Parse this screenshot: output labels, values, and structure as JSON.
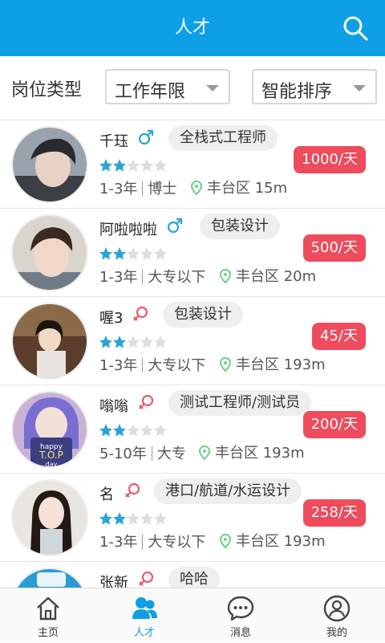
{
  "header": {
    "title": "人才"
  },
  "filters": {
    "label": "岗位类型",
    "dropdown_1": "工作年限",
    "dropdown_2": "智能排序"
  },
  "colors": {
    "brand": "#0EA0E6",
    "price": "#EE4B5C",
    "male": "#2BA3D9",
    "female": "#EA5A6E",
    "location": "#6ED08A"
  },
  "talents": [
    {
      "name": "千珏",
      "gender": "male",
      "tag": "全栈式工程师",
      "price": "1000/天",
      "rating": 2,
      "experience": "1-3年",
      "education": "博士",
      "location": "丰台区 15m"
    },
    {
      "name": "阿啦啦啦",
      "gender": "male",
      "tag": "包装设计",
      "price": "500/天",
      "rating": 2,
      "experience": "1-3年",
      "education": "大专以下",
      "location": "丰台区 20m"
    },
    {
      "name": "喔3",
      "gender": "female",
      "tag": "包装设计",
      "price": "45/天",
      "rating": 2,
      "experience": "1-3年",
      "education": "大专以下",
      "location": "丰台区 193m"
    },
    {
      "name": "嗡嗡",
      "gender": "female",
      "tag": "测试工程师/测试员",
      "price": "200/天",
      "rating": 2,
      "experience": "5-10年",
      "education": "大专",
      "location": "丰台区 193m"
    },
    {
      "name": "名",
      "gender": "female",
      "tag": "港口/航道/水运设计",
      "price": "258/天",
      "rating": 2,
      "experience": "1-3年",
      "education": "大专以下",
      "location": "丰台区 193m"
    },
    {
      "name": "张新",
      "gender": "female",
      "tag": "哈哈"
    }
  ],
  "tabbar": {
    "home": "主页",
    "talent": "人才",
    "messages": "消息",
    "mine": "我的"
  }
}
